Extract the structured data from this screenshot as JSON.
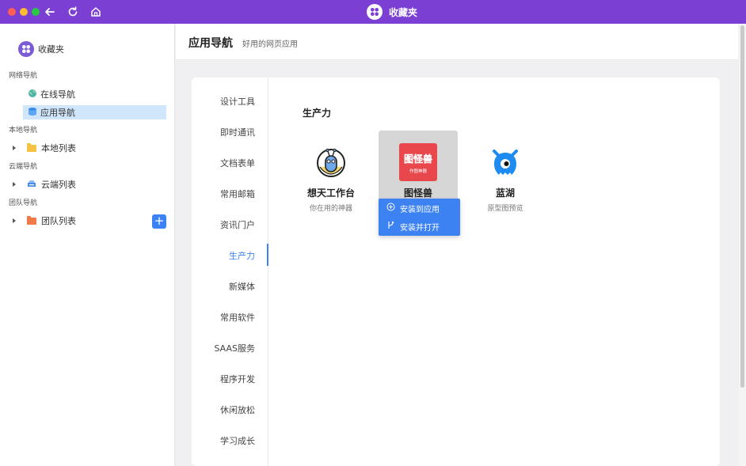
{
  "window": {
    "title": "收藏夹"
  },
  "sidebar": {
    "brand": "收藏夹",
    "sections": [
      {
        "label": "网络导航"
      },
      {
        "label": "本地导航"
      },
      {
        "label": "云端导航"
      },
      {
        "label": "团队导航"
      }
    ],
    "items": [
      {
        "label": "在线导航",
        "icon": "globe-icon"
      },
      {
        "label": "应用导航",
        "icon": "database-icon"
      },
      {
        "label": "本地列表",
        "icon": "folder-icon",
        "color": "#f5c242"
      },
      {
        "label": "云端列表",
        "icon": "cloud-drive-icon",
        "color": "#4a8ee8"
      },
      {
        "label": "团队列表",
        "icon": "folder-icon",
        "color": "#f07a4a"
      }
    ],
    "add_label": "+"
  },
  "header": {
    "title": "应用导航",
    "subtitle": "好用的网页应用"
  },
  "categories": [
    {
      "label": "设计工具"
    },
    {
      "label": "即时通讯"
    },
    {
      "label": "文档表单"
    },
    {
      "label": "常用邮箱"
    },
    {
      "label": "资讯门户"
    },
    {
      "label": "生产力",
      "active": true
    },
    {
      "label": "新媒体"
    },
    {
      "label": "常用软件"
    },
    {
      "label": "SAAS服务"
    },
    {
      "label": "程序开发"
    },
    {
      "label": "休闲放松"
    },
    {
      "label": "学习成长"
    }
  ],
  "section": {
    "title": "生产力"
  },
  "apps": [
    {
      "name": "想天工作台",
      "desc": "你在用的神器",
      "icon": "robot-mascot-icon"
    },
    {
      "name": "图怪兽",
      "desc": "",
      "icon": "tuguaishou-logo-icon",
      "logo_text": "图怪兽",
      "logo_subtext": "作图神器"
    },
    {
      "name": "蓝湖",
      "desc": "原型图预览",
      "icon": "blue-monster-icon"
    }
  ],
  "popup": {
    "items": [
      {
        "label": "安装到应用",
        "icon": "add-circle-icon"
      },
      {
        "label": "安装并打开",
        "icon": "branch-icon"
      }
    ]
  },
  "colors": {
    "titlebar": "#7b3fd4",
    "accent": "#3b82f6",
    "popup": "#3d82f2"
  }
}
